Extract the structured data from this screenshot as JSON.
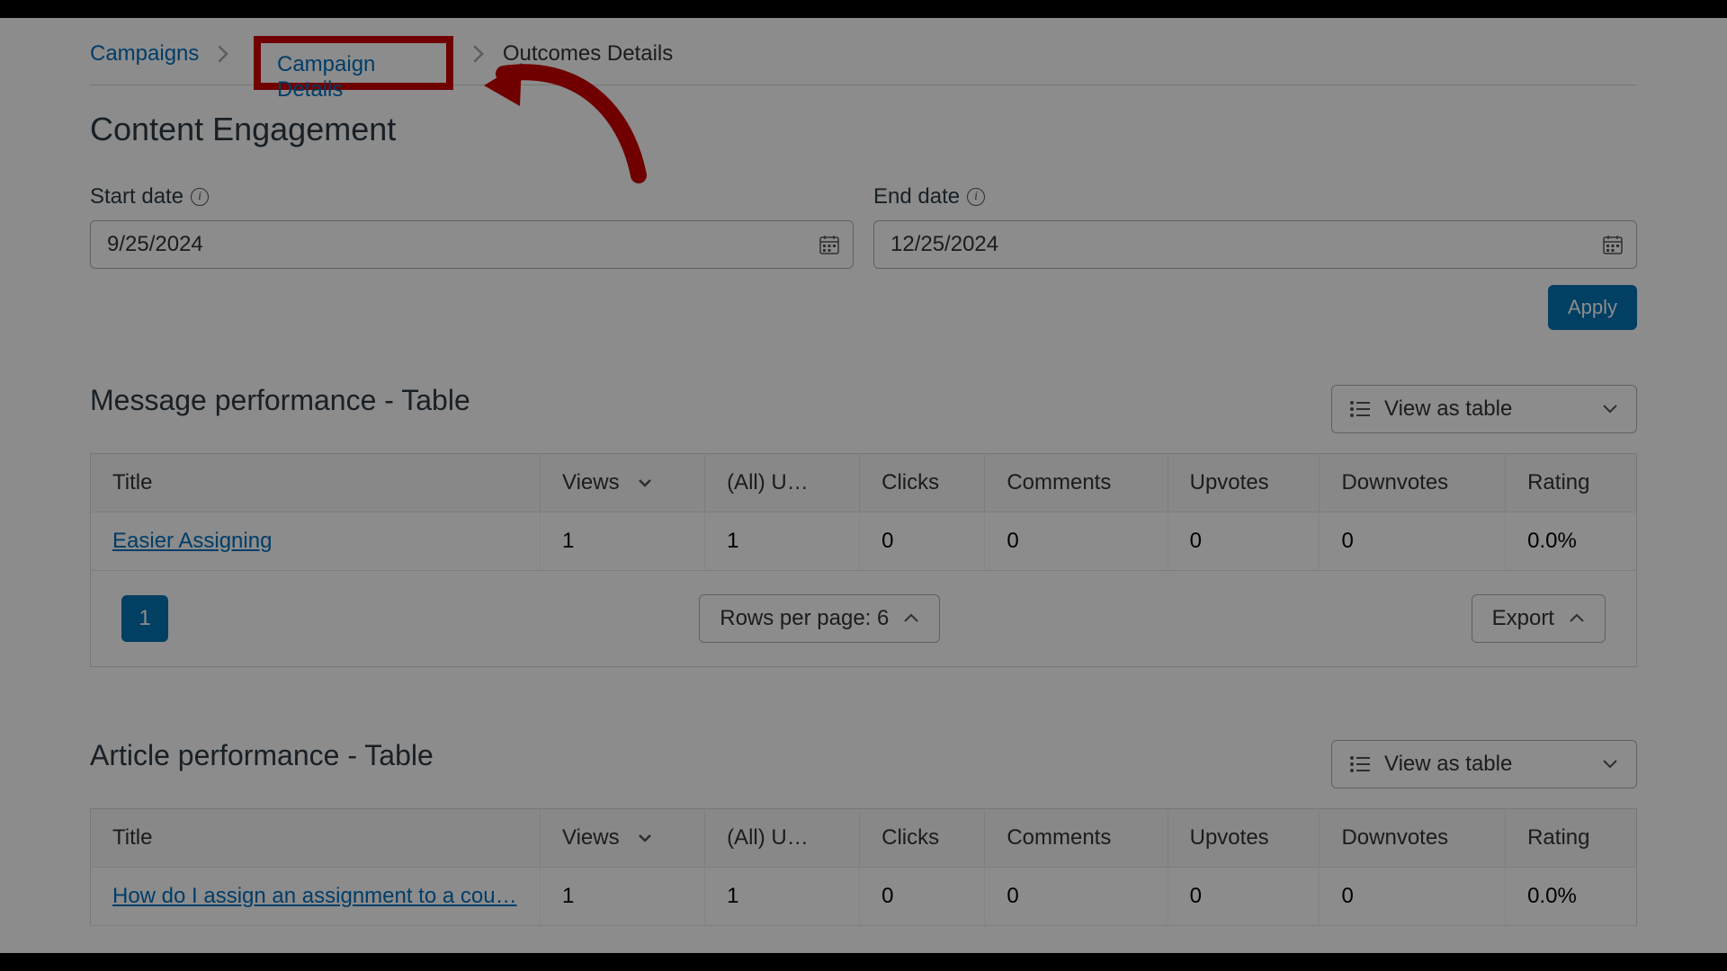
{
  "breadcrumb": {
    "items": [
      {
        "label": "Campaigns",
        "link": true
      },
      {
        "label": "Campaign Details",
        "link": true,
        "highlighted": true
      },
      {
        "label": "Outcomes Details",
        "link": false
      }
    ]
  },
  "page": {
    "title": "Content Engagement"
  },
  "dates": {
    "start_label": "Start date",
    "start_value": "9/25/2024",
    "end_label": "End date",
    "end_value": "12/25/2024",
    "apply_label": "Apply"
  },
  "sections": {
    "message": {
      "title": "Message performance - Table",
      "view_as_label": "View as table",
      "columns": [
        "Title",
        "Views",
        "(All) U…",
        "Clicks",
        "Comments",
        "Upvotes",
        "Downvotes",
        "Rating"
      ],
      "rows": [
        {
          "title": "Easier Assigning",
          "views": "1",
          "allu": "1",
          "clicks": "0",
          "comments": "0",
          "upvotes": "0",
          "downvotes": "0",
          "rating": "0.0%"
        }
      ],
      "page_current": "1",
      "rows_per_page_label": "Rows per page: 6",
      "export_label": "Export"
    },
    "article": {
      "title": "Article performance - Table",
      "view_as_label": "View as table",
      "columns": [
        "Title",
        "Views",
        "(All) U…",
        "Clicks",
        "Comments",
        "Upvotes",
        "Downvotes",
        "Rating"
      ],
      "rows": [
        {
          "title": "How do I assign an assignment to a cou…",
          "views": "1",
          "allu": "1",
          "clicks": "0",
          "comments": "0",
          "upvotes": "0",
          "downvotes": "0",
          "rating": "0.0%"
        }
      ]
    }
  },
  "annotation": {
    "highlight_target": "Campaign Details",
    "highlight_color": "#c00",
    "arrow_color": "#c00"
  }
}
